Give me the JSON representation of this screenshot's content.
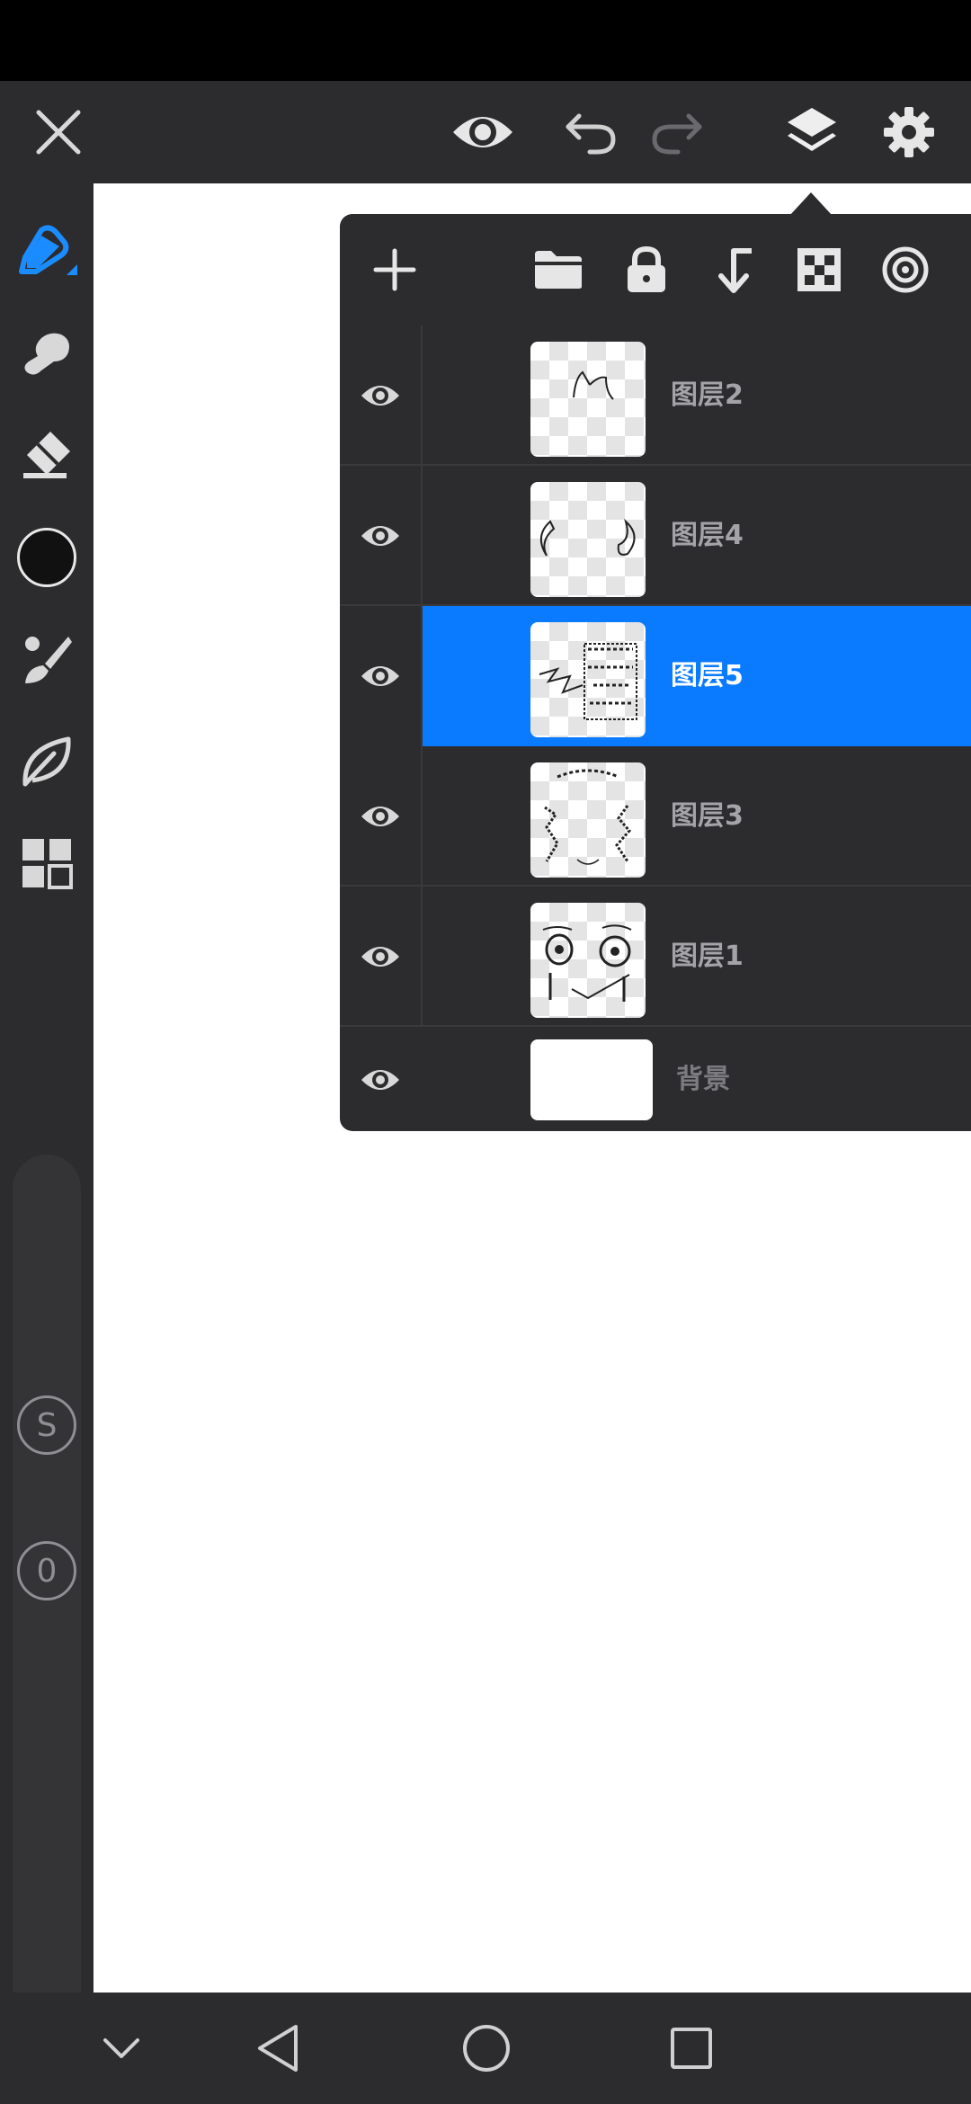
{
  "toolbar": {
    "close": "close-icon",
    "view": "eye-icon",
    "undo": "undo-icon",
    "redo": "redo-icon",
    "layers": "layers-icon",
    "settings": "gear-icon"
  },
  "left_tools": [
    "pen-icon",
    "smudge-icon",
    "eraser-icon",
    "color-swatch",
    "brush-icon",
    "leaf-icon",
    "grid-icon"
  ],
  "current_color": "#111111",
  "slider_labels": {
    "size": "S",
    "opacity": "0"
  },
  "layers_panel": {
    "header_actions": [
      "add-icon",
      "folder-icon",
      "lock-icon",
      "merge-down-icon",
      "alpha-checker-icon",
      "target-icon"
    ],
    "layers": [
      {
        "name": "图层2",
        "visible": true,
        "selected": false
      },
      {
        "name": "图层4",
        "visible": true,
        "selected": false
      },
      {
        "name": "图层5",
        "visible": true,
        "selected": true
      },
      {
        "name": "图层3",
        "visible": true,
        "selected": false
      },
      {
        "name": "图层1",
        "visible": true,
        "selected": false
      }
    ],
    "background": {
      "name": "背景",
      "visible": true
    }
  },
  "colors": {
    "accent": "#0a7aff",
    "panel": "#2c2c2e",
    "toolbar": "#2c2c2e"
  },
  "nav": [
    "chevron-down-icon",
    "back-icon",
    "home-icon",
    "recents-icon"
  ]
}
